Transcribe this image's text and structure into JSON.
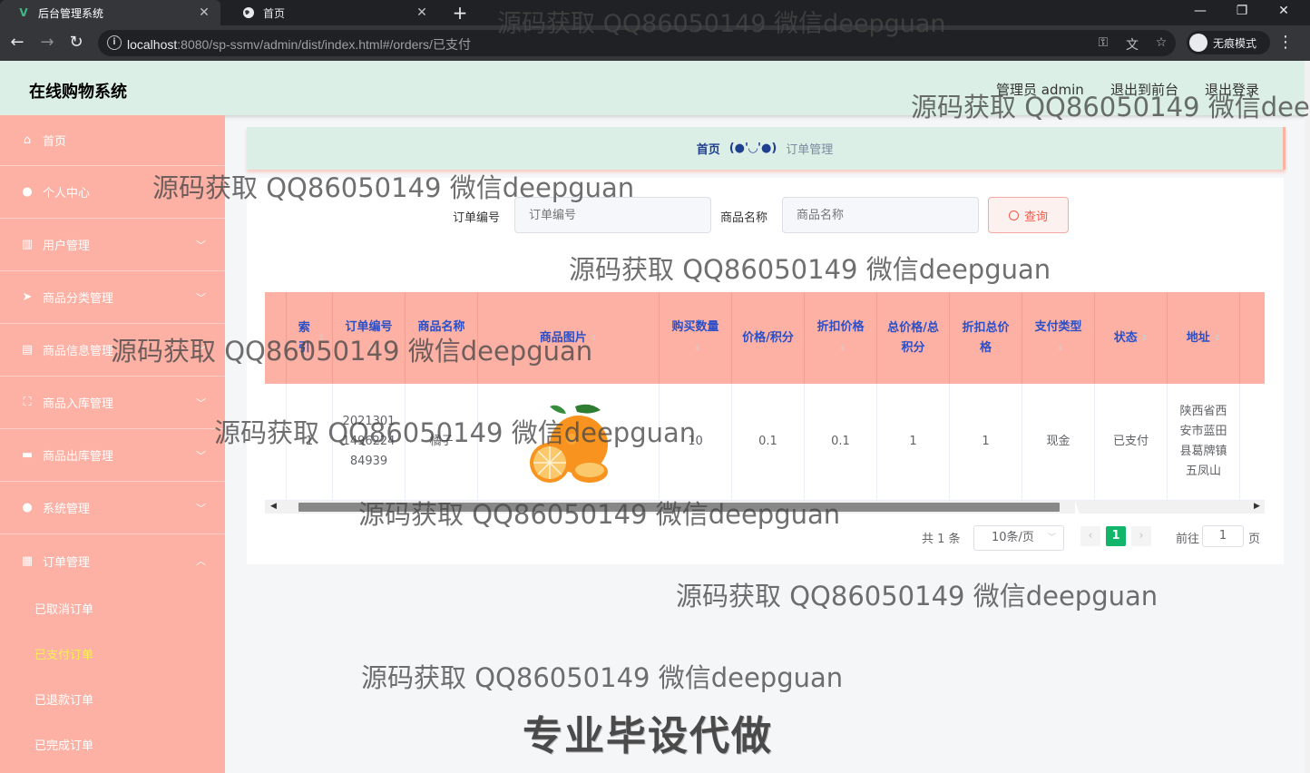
{
  "browser": {
    "tabs": [
      {
        "title": "后台管理系统",
        "favicon": "vue-logo-icon",
        "active": true
      },
      {
        "title": "首页",
        "favicon": "globe-icon",
        "active": false
      }
    ],
    "url_host": "localhost",
    "url_rest": ":8080/sp-ssmv/admin/dist/index.html#/orders/已支付",
    "incognito_label": "无痕模式"
  },
  "header": {
    "title": "在线购物系统",
    "user": "管理员 admin",
    "to_front": "退出到前台",
    "logout": "退出登录"
  },
  "sidebar": {
    "items": [
      {
        "label": "首页",
        "icon": "home-icon",
        "expandable": false
      },
      {
        "label": "个人中心",
        "icon": "user-icon",
        "expandable": false
      },
      {
        "label": "用户管理",
        "icon": "bars-icon",
        "expandable": true
      },
      {
        "label": "商品分类管理",
        "icon": "send-icon",
        "expandable": true
      },
      {
        "label": "商品信息管理",
        "icon": "chart-icon",
        "expandable": true
      },
      {
        "label": "商品入库管理",
        "icon": "fullscreen-icon",
        "expandable": true
      },
      {
        "label": "商品出库管理",
        "icon": "briefcase-icon",
        "expandable": true
      },
      {
        "label": "系统管理",
        "icon": "user-icon",
        "expandable": true
      },
      {
        "label": "订单管理",
        "icon": "clipboard-icon",
        "expandable": true,
        "open": true
      }
    ],
    "subitems": [
      {
        "label": "已取消订单",
        "active": false
      },
      {
        "label": "已支付订单",
        "active": true
      },
      {
        "label": "已退款订单",
        "active": false
      },
      {
        "label": "已完成订单",
        "active": false
      }
    ]
  },
  "breadcrumb": {
    "home": "首页",
    "separator": "(●'◡'●)",
    "current": "订单管理"
  },
  "filters": {
    "order_no_label": "订单编号",
    "order_no_placeholder": "订单编号",
    "product_label": "商品名称",
    "product_placeholder": "商品名称",
    "query_button": "查询"
  },
  "table": {
    "headers": [
      "索引",
      "订单编号",
      "商品名称",
      "商品图片",
      "购买数量",
      "价格/积分",
      "折扣价格",
      "总价格/总积分",
      "折扣总价格",
      "支付类型",
      "状态",
      "地址"
    ],
    "rows": [
      {
        "index": "1",
        "order_no": "20213011496224 84939",
        "product": "橘子",
        "image": "orange-image",
        "quantity": "10",
        "price": "0.1",
        "discount_price": "0.1",
        "total": "1",
        "discount_total": "1",
        "pay_type": "现金",
        "status": "已支付",
        "address": "陕西省西安市蓝田县葛牌镇五凤山"
      }
    ]
  },
  "pagination": {
    "total": "共 1 条",
    "page_size": "10条/页",
    "current_page": "1",
    "goto_prefix": "前往",
    "goto_value": "1",
    "goto_suffix": "页"
  },
  "watermarks": {
    "text": "源码获取 QQ86050149 微信deepguan",
    "banner": "专业毕设代做"
  },
  "colors": {
    "sidebar": "#fcb1a4",
    "header": "#dbefe6",
    "header_text": "#2b4fc7",
    "active_sub": "#ffee58",
    "page_active": "#13b56b",
    "query": "#f05a4a"
  }
}
